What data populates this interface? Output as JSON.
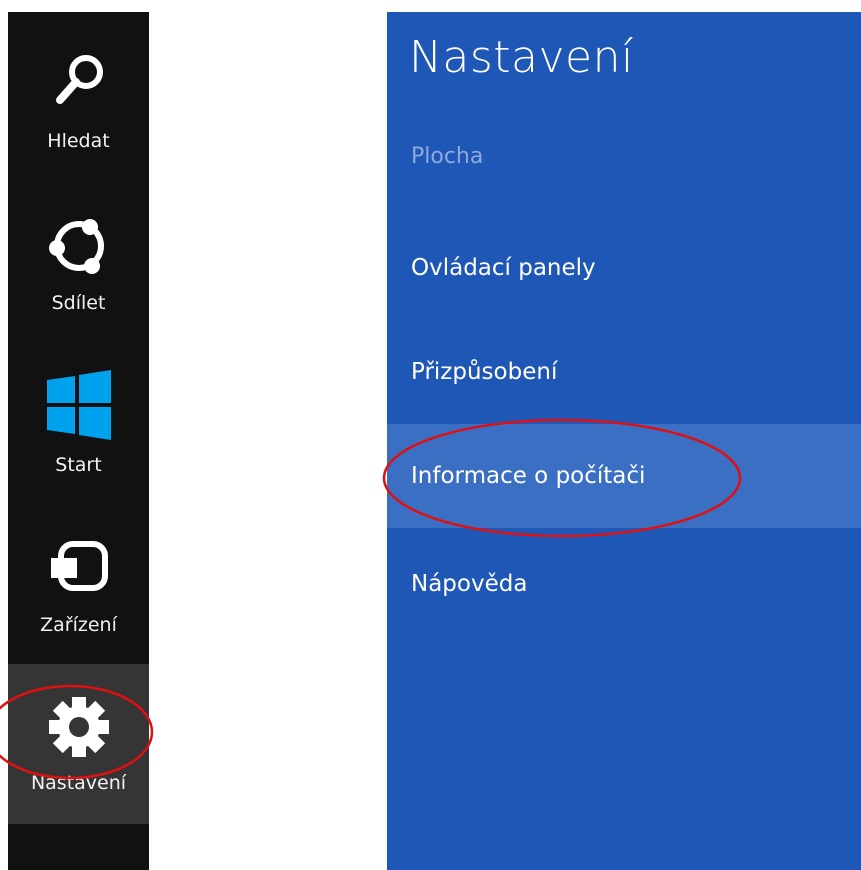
{
  "charms": {
    "items": [
      {
        "label": "Hledat",
        "icon": "search-icon"
      },
      {
        "label": "Sdílet",
        "icon": "share-icon"
      },
      {
        "label": "Start",
        "icon": "windows-logo-icon"
      },
      {
        "label": "Zařízení",
        "icon": "devices-icon"
      },
      {
        "label": "Nastavení",
        "icon": "gear-icon",
        "active": true
      }
    ]
  },
  "settings_pane": {
    "title": "Nastavení",
    "context": "Plocha",
    "items": [
      {
        "label": "Ovládací panely"
      },
      {
        "label": "Přizpůsobení"
      },
      {
        "label": "Informace o počítači",
        "highlighted": true
      },
      {
        "label": "Nápověda"
      }
    ]
  },
  "colors": {
    "charms_bg": "#111111",
    "charm_active_bg": "#353535",
    "pane_bg": "#1f57b6",
    "pane_item_hover": "#3a6fc4",
    "annotation_red": "#e01010",
    "start_logo": "#00a2ed"
  }
}
